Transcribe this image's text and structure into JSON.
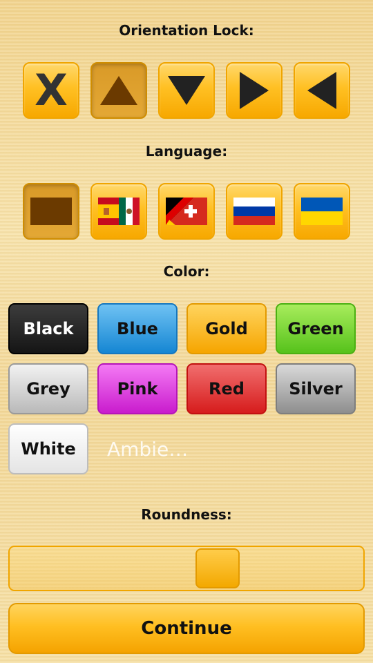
{
  "orientation": {
    "heading": "Orientation Lock:",
    "options": [
      {
        "icon": "x-icon",
        "glyph": "X",
        "selected": false
      },
      {
        "icon": "arrow-up-icon",
        "selected": true
      },
      {
        "icon": "arrow-down-icon",
        "selected": false
      },
      {
        "icon": "arrow-right-icon",
        "selected": false
      },
      {
        "icon": "arrow-left-icon",
        "selected": false
      }
    ]
  },
  "language": {
    "heading": "Language:",
    "options": [
      {
        "icon": "blank-flag-icon",
        "selected": true
      },
      {
        "icon": "spain-mexico-flag-icon",
        "selected": false
      },
      {
        "icon": "germany-switzerland-flag-icon",
        "selected": false
      },
      {
        "icon": "russia-flag-icon",
        "selected": false
      },
      {
        "icon": "ukraine-flag-icon",
        "selected": false
      }
    ]
  },
  "color": {
    "heading": "Color:",
    "buttons": [
      "Black",
      "Blue",
      "Gold",
      "Green",
      "Grey",
      "Pink",
      "Red",
      "Silver",
      "White"
    ],
    "ambient_label": "Ambie…"
  },
  "roundness": {
    "heading": "Roundness:",
    "value_fraction": 0.6
  },
  "continue_label": "Continue",
  "colors": {
    "accent": "#ffc023",
    "accent_border": "#f0a500",
    "selected_brown": "#6b3a00"
  }
}
